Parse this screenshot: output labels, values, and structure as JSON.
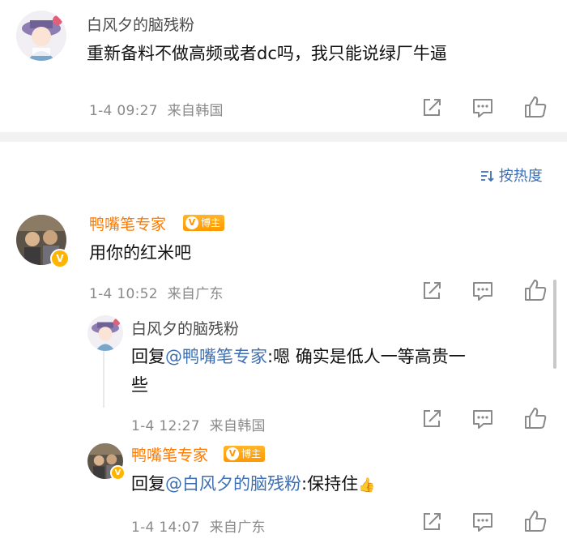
{
  "comment1": {
    "user": "白风夕的脑残粉",
    "text": "重新备料不做高频或者dc吗，我只能说绿厂牛逼",
    "time": "1-4 09:27",
    "location": "来自韩国"
  },
  "sort": {
    "label": "按热度",
    "icon": "sort-icon"
  },
  "comment2": {
    "user": "鸭嘴笔专家",
    "badge": "博主",
    "text": "用你的红米吧",
    "time": "1-4 10:52",
    "location": "来自广东"
  },
  "reply1": {
    "user": "白风夕的脑残粉",
    "prefix": "回复",
    "mention": "@鸭嘴笔专家",
    "text_line1": ":嗯 确实是低人一等高贵一",
    "text_line2": "些",
    "time": "1-4 12:27",
    "location": "来自韩国"
  },
  "reply2": {
    "user": "鸭嘴笔专家",
    "badge": "博主",
    "prefix": "回复",
    "mention": "@白风夕的脑残粉",
    "text": ":保持住",
    "emoji": "👍",
    "time": "1-4 14:07",
    "location": "来自广东"
  },
  "colors": {
    "accent_orange": "#ff7a00",
    "mention_blue": "#3e6fb3",
    "meta_gray": "#8a8a8a"
  },
  "icons": [
    "share-icon",
    "comment-icon",
    "like-icon"
  ]
}
